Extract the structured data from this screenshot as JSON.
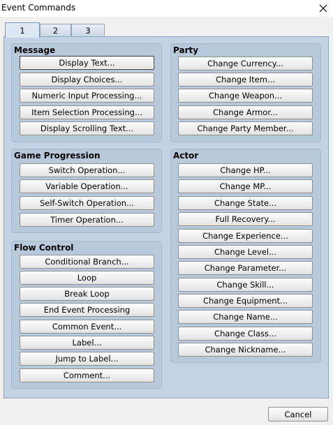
{
  "window": {
    "title": "Event Commands"
  },
  "tabs": [
    "1",
    "2",
    "3"
  ],
  "groups": {
    "message": {
      "label": "Message",
      "buttons": [
        "Display Text...",
        "Display Choices...",
        "Numeric Input Processing...",
        "Item Selection Processing...",
        "Display Scrolling Text..."
      ]
    },
    "game_progression": {
      "label": "Game Progression",
      "buttons": [
        "Switch Operation...",
        "Variable Operation...",
        "Self-Switch Operation...",
        "Timer Operation..."
      ]
    },
    "flow_control": {
      "label": "Flow Control",
      "buttons": [
        "Conditional Branch...",
        "Loop",
        "Break Loop",
        "End Event Processing",
        "Common Event...",
        "Label...",
        "Jump to Label...",
        "Comment..."
      ]
    },
    "party": {
      "label": "Party",
      "buttons": [
        "Change Currency...",
        "Change Item...",
        "Change Weapon...",
        "Change Armor...",
        "Change Party Member..."
      ]
    },
    "actor": {
      "label": "Actor",
      "buttons": [
        "Change HP...",
        "Change MP...",
        "Change State...",
        "Full Recovery...",
        "Change Experience...",
        "Change Level...",
        "Change Parameter...",
        "Change Skill...",
        "Change Equipment...",
        "Change Name...",
        "Change Class...",
        "Change Nickname..."
      ]
    }
  },
  "footer": {
    "cancel_label": "Cancel"
  },
  "icons": {
    "close": "close-icon"
  }
}
